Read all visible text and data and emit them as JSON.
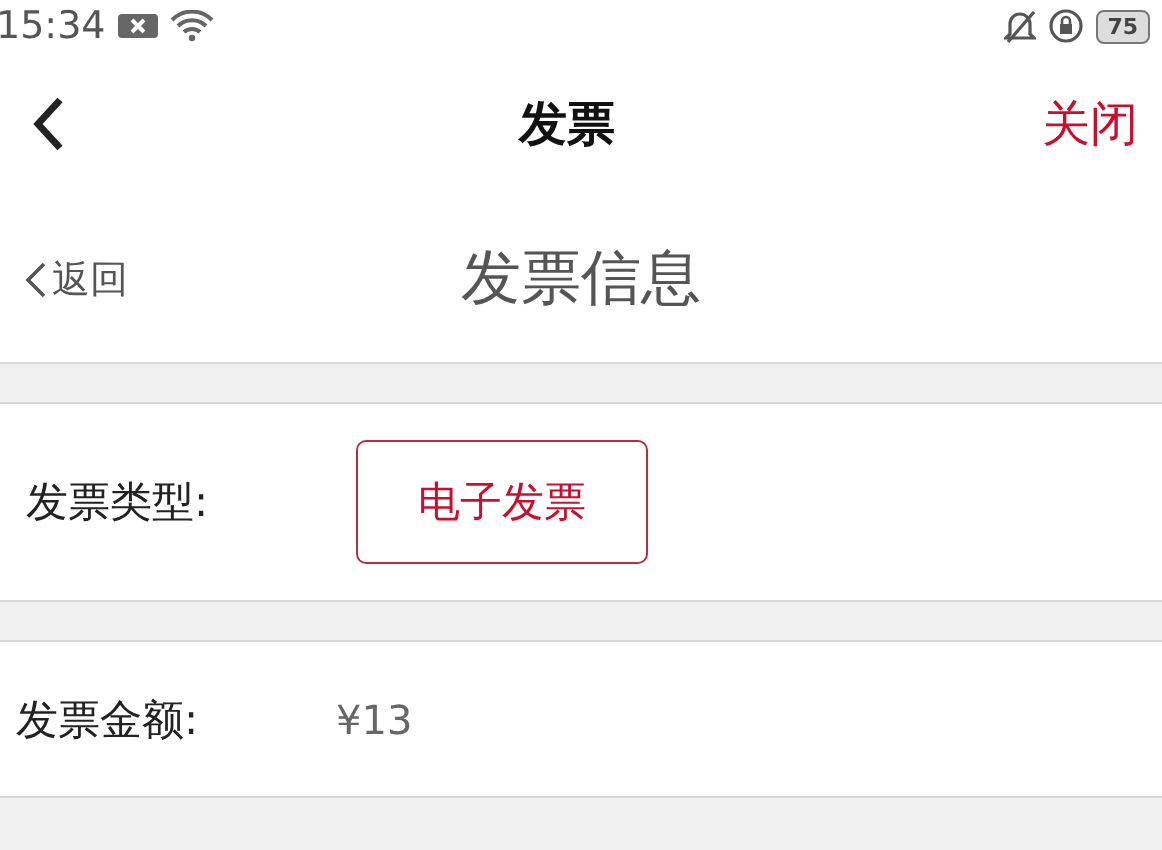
{
  "status_bar": {
    "time": "15:34",
    "battery": "75"
  },
  "nav_bar": {
    "title": "发票",
    "close": "关闭"
  },
  "sub_header": {
    "back": "返回",
    "title": "发票信息"
  },
  "invoice_type": {
    "label": "发票类型:",
    "options": [
      {
        "label": "电子发票",
        "selected": true
      }
    ]
  },
  "invoice_amount": {
    "label": "发票金额:",
    "value": "¥13"
  }
}
